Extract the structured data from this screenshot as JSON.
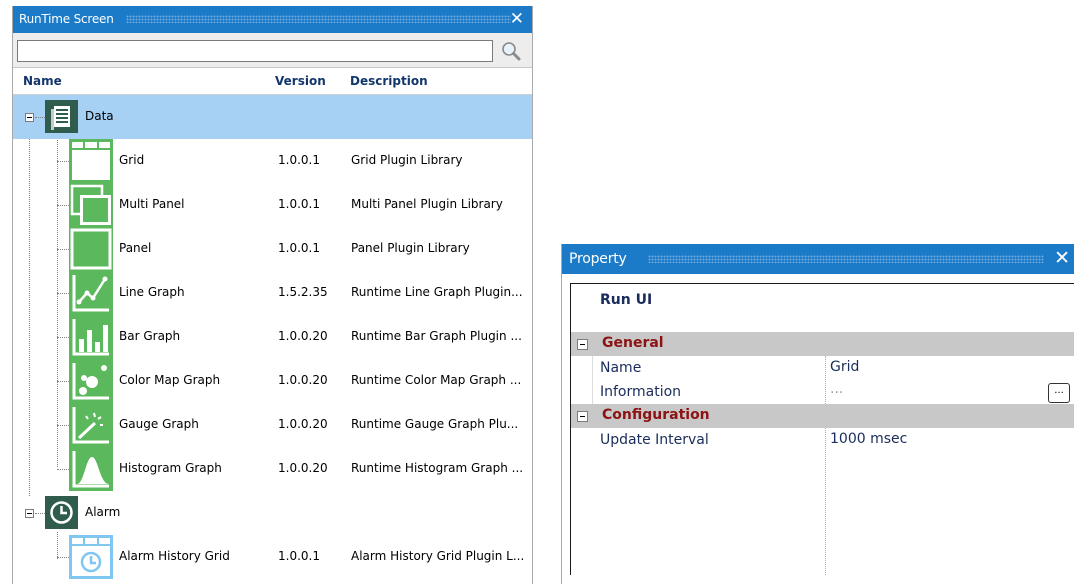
{
  "runtime_panel": {
    "title": "RunTime Screen",
    "search": {
      "value": "",
      "placeholder": ""
    },
    "columns": {
      "name": "Name",
      "version": "Version",
      "description": "Description"
    },
    "groups": [
      {
        "label": "Data",
        "icon": "data-document-icon",
        "items": [
          {
            "name": "Grid",
            "version": "1.0.0.1",
            "description": "Grid Plugin Library",
            "icon": "grid-icon"
          },
          {
            "name": "Multi Panel",
            "version": "1.0.0.1",
            "description": "Multi Panel Plugin Library",
            "icon": "multi-panel-icon"
          },
          {
            "name": "Panel",
            "version": "1.0.0.1",
            "description": "Panel Plugin Library",
            "icon": "panel-icon"
          },
          {
            "name": "Line Graph",
            "version": "1.5.2.35",
            "description": "Runtime Line Graph Plugin...",
            "icon": "line-graph-icon"
          },
          {
            "name": "Bar Graph",
            "version": "1.0.0.20",
            "description": "Runtime Bar Graph Plugin ...",
            "icon": "bar-graph-icon"
          },
          {
            "name": "Color Map Graph",
            "version": "1.0.0.20",
            "description": "Runtime Color Map Graph ...",
            "icon": "color-map-graph-icon"
          },
          {
            "name": "Gauge Graph",
            "version": "1.0.0.20",
            "description": "Runtime Gauge Graph Plu...",
            "icon": "gauge-graph-icon"
          },
          {
            "name": "Histogram Graph",
            "version": "1.0.0.20",
            "description": "Runtime Histogram Graph ...",
            "icon": "histogram-graph-icon"
          }
        ]
      },
      {
        "label": "Alarm",
        "icon": "clock-icon",
        "items": [
          {
            "name": "Alarm History Grid",
            "version": "1.0.0.1",
            "description": "Alarm History Grid Plugin L...",
            "icon": "alarm-history-grid-icon"
          }
        ]
      }
    ]
  },
  "property_panel": {
    "title": "Property",
    "object_title": "Run UI",
    "categories": [
      {
        "name": "General",
        "rows": [
          {
            "name": "Name",
            "value": "Grid"
          },
          {
            "name": "Information",
            "value": "...",
            "button": "..."
          }
        ]
      },
      {
        "name": "Configuration",
        "rows": [
          {
            "name": "Update Interval",
            "value": "1000 msec"
          }
        ]
      }
    ]
  },
  "colors": {
    "titlebar": "#1c7bc9",
    "selection": "#a6d1f5",
    "icon_green": "#5cb85c",
    "icon_dark": "#2f5c4c",
    "icon_blue": "#7fc6f0",
    "category_bg": "#c8c8c8",
    "category_text": "#8b1313"
  }
}
